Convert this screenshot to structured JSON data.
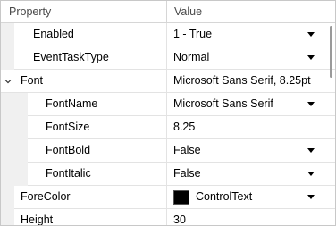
{
  "header": {
    "property_label": "Property",
    "value_label": "Value"
  },
  "rows": [
    {
      "name": "Enabled",
      "value": "1 - True",
      "has_dropdown": true
    },
    {
      "name": "EventTaskType",
      "value": "Normal",
      "has_dropdown": true
    },
    {
      "name": "Font",
      "value": "Microsoft Sans Serif, 8.25pt",
      "expanded": true
    },
    {
      "name": "FontName",
      "value": "Microsoft Sans Serif",
      "has_dropdown": true
    },
    {
      "name": "FontSize",
      "value": "8.25"
    },
    {
      "name": "FontBold",
      "value": "False",
      "has_dropdown": true
    },
    {
      "name": "FontItalic",
      "value": "False",
      "has_dropdown": true
    },
    {
      "name": "ForeColor",
      "value": "ControlText",
      "swatch_color": "#000000",
      "has_dropdown": true
    },
    {
      "name": "Height",
      "value": "30"
    }
  ],
  "icons": {
    "expander": "chevron-down-icon",
    "dropdown": "dropdown-arrow-icon"
  }
}
